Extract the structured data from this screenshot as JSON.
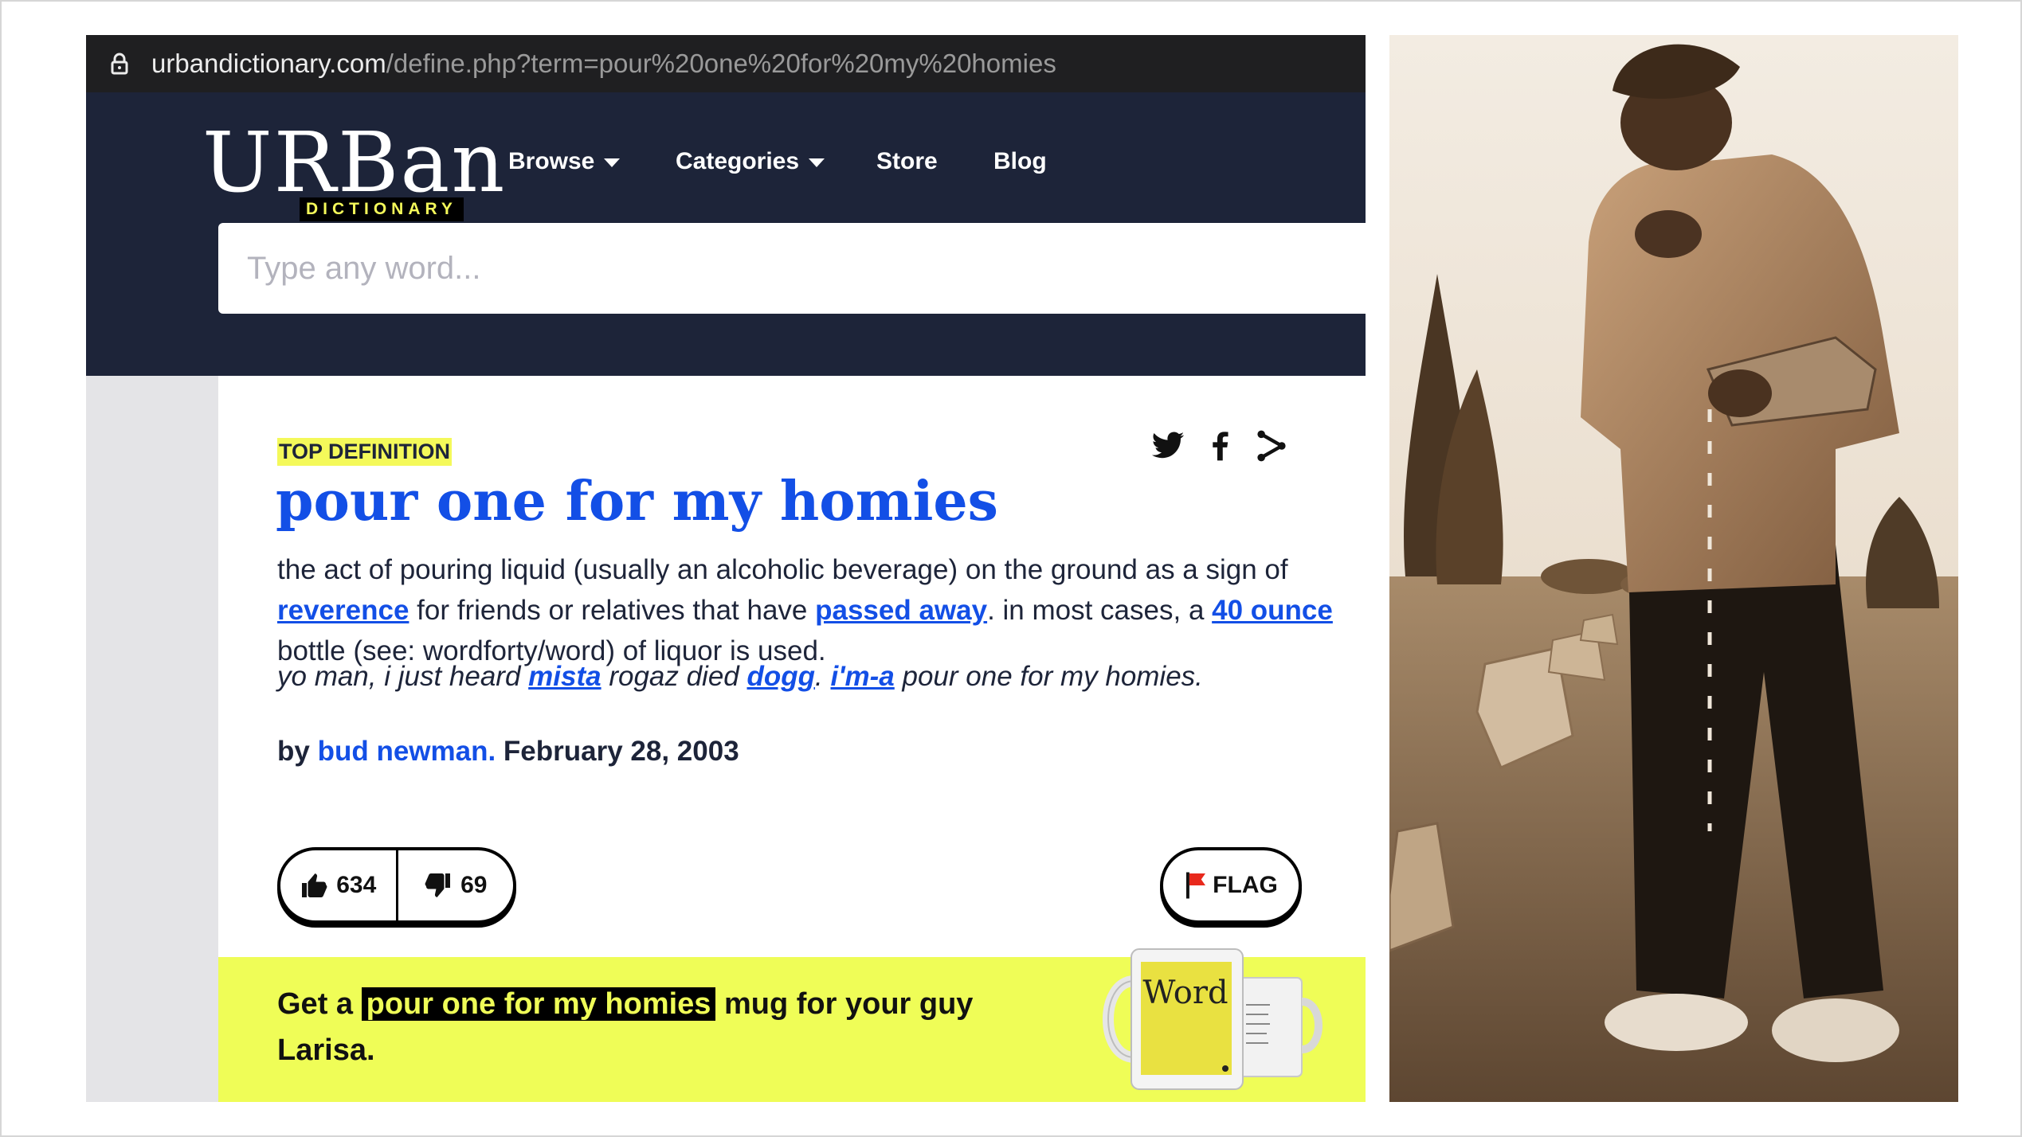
{
  "browser": {
    "url_domain": "urbandictionary.com",
    "url_path": "/define.php?term=pour%20one%20for%20my%20homies"
  },
  "logo": {
    "word": "URBan",
    "sub": "DICTIONARY"
  },
  "nav": {
    "items": [
      {
        "label": "Browse",
        "has_dropdown": true
      },
      {
        "label": "Categories",
        "has_dropdown": true
      },
      {
        "label": "Store",
        "has_dropdown": false
      },
      {
        "label": "Blog",
        "has_dropdown": false
      }
    ]
  },
  "search": {
    "placeholder": "Type any word..."
  },
  "definition": {
    "badge": "TOP DEFINITION",
    "term": "pour one for my homies",
    "meaning_parts": {
      "p1": "the act of pouring liquid (usually an alcoholic beverage) on the ground as a sign of ",
      "link1": "reverence",
      "p2": " for friends or relatives that have ",
      "link2": "passed away",
      "p3": ". in most cases, a ",
      "link3": "40 ounce",
      "p4": " bottle (see: wordforty/word) of liquor is used."
    },
    "example_parts": {
      "p1": "yo man, i just heard ",
      "link1": "mista",
      "p2": " rogaz died ",
      "link2": "dogg",
      "p3": ". ",
      "link3": "i'm-a",
      "p4": " pour one for my homies."
    },
    "byline": {
      "by": "by ",
      "author": "bud newman.",
      "date": " February 28, 2003"
    },
    "upvotes": "634",
    "downvotes": "69",
    "flag_label": "FLAG"
  },
  "share_icons": [
    "twitter-icon",
    "facebook-icon",
    "share-icon"
  ],
  "promo": {
    "prefix": "Get a ",
    "highlight": "pour one for my homies",
    "suffix": " mug for your guy Larisa.",
    "mug_word": "Word"
  },
  "colors": {
    "nav_bg": "#1d2439",
    "link_blue": "#134fe6",
    "highlight_yellow": "#effd57",
    "badge_yellow": "#f4f95a"
  }
}
